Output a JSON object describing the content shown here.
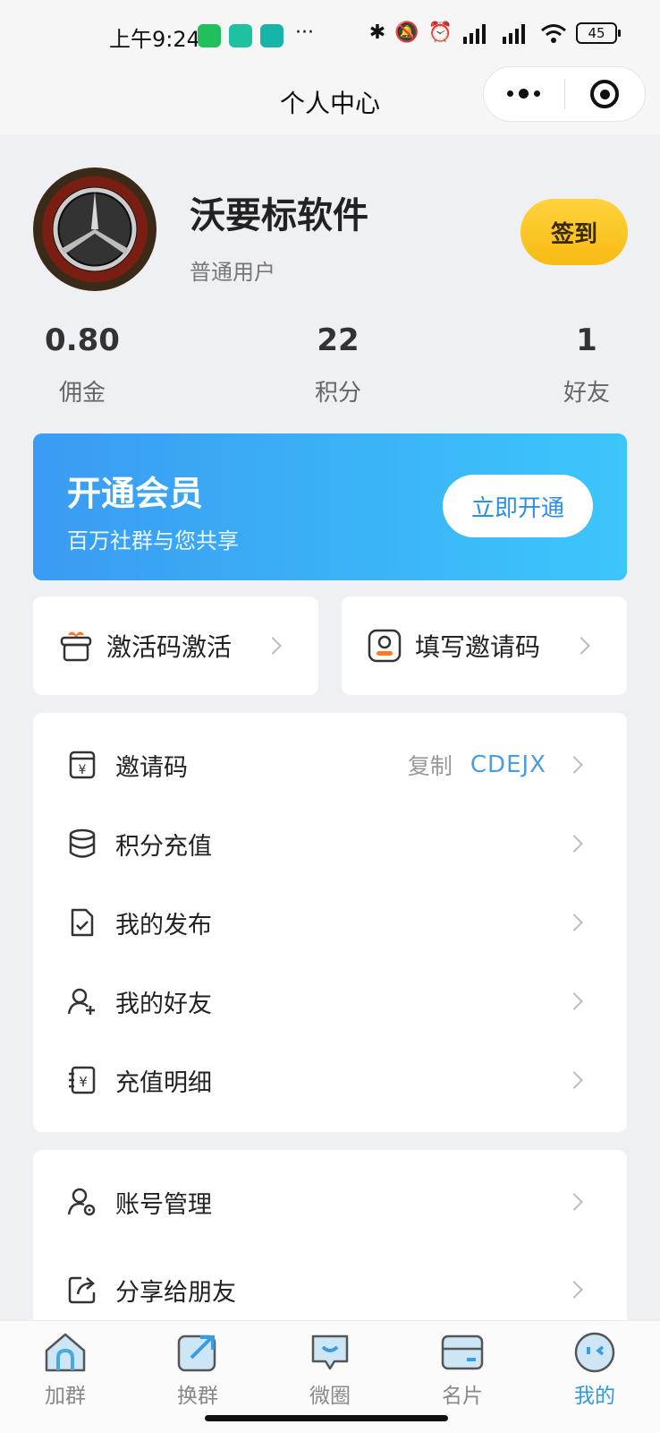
{
  "status_bar": {
    "time": "上午9:24",
    "more": "···",
    "battery": "45",
    "icons": [
      "wechat-icon",
      "app-icon",
      "boss-app-icon",
      "bluetooth-icon",
      "mute-icon",
      "alarm-icon",
      "signal-icon",
      "signal-icon",
      "wifi-icon",
      "battery-icon"
    ]
  },
  "nav": {
    "title": "个人中心"
  },
  "profile": {
    "name": "沃要标软件",
    "level": "普通用户",
    "signin_label": "签到"
  },
  "stats": [
    {
      "value": "0.80",
      "label": "佣金"
    },
    {
      "value": "22",
      "label": "积分"
    },
    {
      "value": "1",
      "label": "好友"
    }
  ],
  "vip": {
    "title": "开通会员",
    "subtitle": "百万社群与您共享",
    "button": "立即开通",
    "colors": [
      "#3a9bf2",
      "#3cc6fb"
    ]
  },
  "quick_actions": [
    {
      "label": "激活码激活",
      "icon": "gift-icon"
    },
    {
      "label": "填写邀请码",
      "icon": "id-card-icon"
    }
  ],
  "menu_main": {
    "invite": {
      "label": "邀请码",
      "copy_label": "复制",
      "code": "CDEJX",
      "icon": "invite-code-icon"
    },
    "items": [
      {
        "label": "积分充值",
        "icon": "database-icon"
      },
      {
        "label": "我的发布",
        "icon": "document-check-icon"
      },
      {
        "label": "我的好友",
        "icon": "add-friend-icon"
      },
      {
        "label": "充值明细",
        "icon": "recharge-detail-icon"
      }
    ]
  },
  "menu_secondary": {
    "items": [
      {
        "label": "账号管理",
        "icon": "account-settings-icon"
      },
      {
        "label": "分享给朋友",
        "icon": "share-icon"
      }
    ]
  },
  "tabs": [
    {
      "label": "加群",
      "icon": "join-group-icon"
    },
    {
      "label": "换群",
      "icon": "exchange-group-icon"
    },
    {
      "label": "微圈",
      "icon": "moments-icon"
    },
    {
      "label": "名片",
      "icon": "card-icon"
    },
    {
      "label": "我的",
      "icon": "profile-icon",
      "active": true
    }
  ],
  "colors": {
    "accent": "#2f9bd9",
    "signin": "#f7bb13"
  }
}
